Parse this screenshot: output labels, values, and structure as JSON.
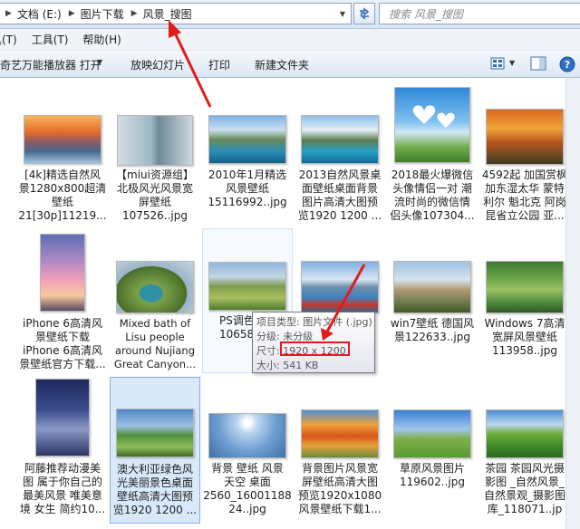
{
  "address": {
    "crumbs": [
      "文档 (E:)",
      "图片下载",
      "风景_搜图"
    ]
  },
  "search": {
    "placeholder": "搜索 风景_搜图"
  },
  "menu": {
    "items": [
      "具(T)",
      "工具(T)",
      "帮助(H)"
    ]
  },
  "toolbar": {
    "open_with": "奇艺万能播放器 打开",
    "slideshow": "放映幻灯片",
    "print": "打印",
    "new_folder": "新建文件夹"
  },
  "files": [
    {
      "lines": [
        "[4k]精选自然风",
        "景1280x800超清",
        "壁纸",
        "21[30p]11219..."
      ]
    },
    {
      "lines": [
        "【miui资源组】",
        "北极风光风景宽",
        "屏壁纸",
        "107526..jpg"
      ]
    },
    {
      "lines": [
        "2010年1月精选",
        "风景壁纸",
        "15116992..jpg"
      ]
    },
    {
      "lines": [
        "2013自然风景桌",
        "面壁纸桌面背景",
        "图片高清大图预",
        "览1920 1200 ..."
      ]
    },
    {
      "lines": [
        "2018最火爆微信",
        "头像情侣一对 潮",
        "流时尚的微信情",
        "侣头像107304..."
      ]
    },
    {
      "lines": [
        "4592起 加国赏枫",
        "加东湿太华 蒙特",
        "利尔 魁北克 阿岗",
        "昆省立公园 亚..."
      ]
    },
    {
      "lines": [
        "iPhone 6高清风",
        "景壁纸下载",
        "iPhone 6高清风",
        "景壁纸官方下载..."
      ]
    },
    {
      "lines": [
        "Mixed bath of",
        "Lisu people",
        "around Nujiang",
        "Great Canyon..."
      ]
    },
    {
      "lines": [
        "PS调色",
        "10658"
      ]
    },
    {
      "lines": []
    },
    {
      "lines": [
        "win7壁纸 德国风",
        "景122633..jpg"
      ]
    },
    {
      "lines": [
        "Windows 7高清",
        "宽屏风景壁纸",
        "113958..jpg"
      ]
    },
    {
      "lines": [
        "阿藤推荐动漫美",
        "图 属于你自己的",
        "最美风景 唯美意",
        "境 女生 简约10..."
      ]
    },
    {
      "lines": [
        "澳大利亚绿色风",
        "光美丽景色桌面",
        "壁纸高清大图预",
        "览1920 1200 ..."
      ]
    },
    {
      "lines": [
        "背景 壁纸 风景",
        "天空 桌面",
        "2560_16001188",
        "24..jpg"
      ]
    },
    {
      "lines": [
        "背景图片风景宽",
        "屏壁纸高清大图",
        "预览1920x1080",
        "风景壁纸下载1..."
      ]
    },
    {
      "lines": [
        "草原风景图片",
        "119602..jpg"
      ]
    },
    {
      "lines": [
        "茶园 茶园风光摄",
        "影图 _自然风景_",
        "自然景观_摄影图",
        "库_118071..jp"
      ]
    }
  ],
  "tooltip": {
    "type": "项目类型: 图片文件 (.jpg)",
    "rating": "分级: 未分级",
    "dimensions": "尺寸: 1920 x 1200",
    "size": "大小: 541 KB"
  },
  "colors": {
    "annotation": "#e21b1b",
    "selection": "#d9e9fa"
  }
}
